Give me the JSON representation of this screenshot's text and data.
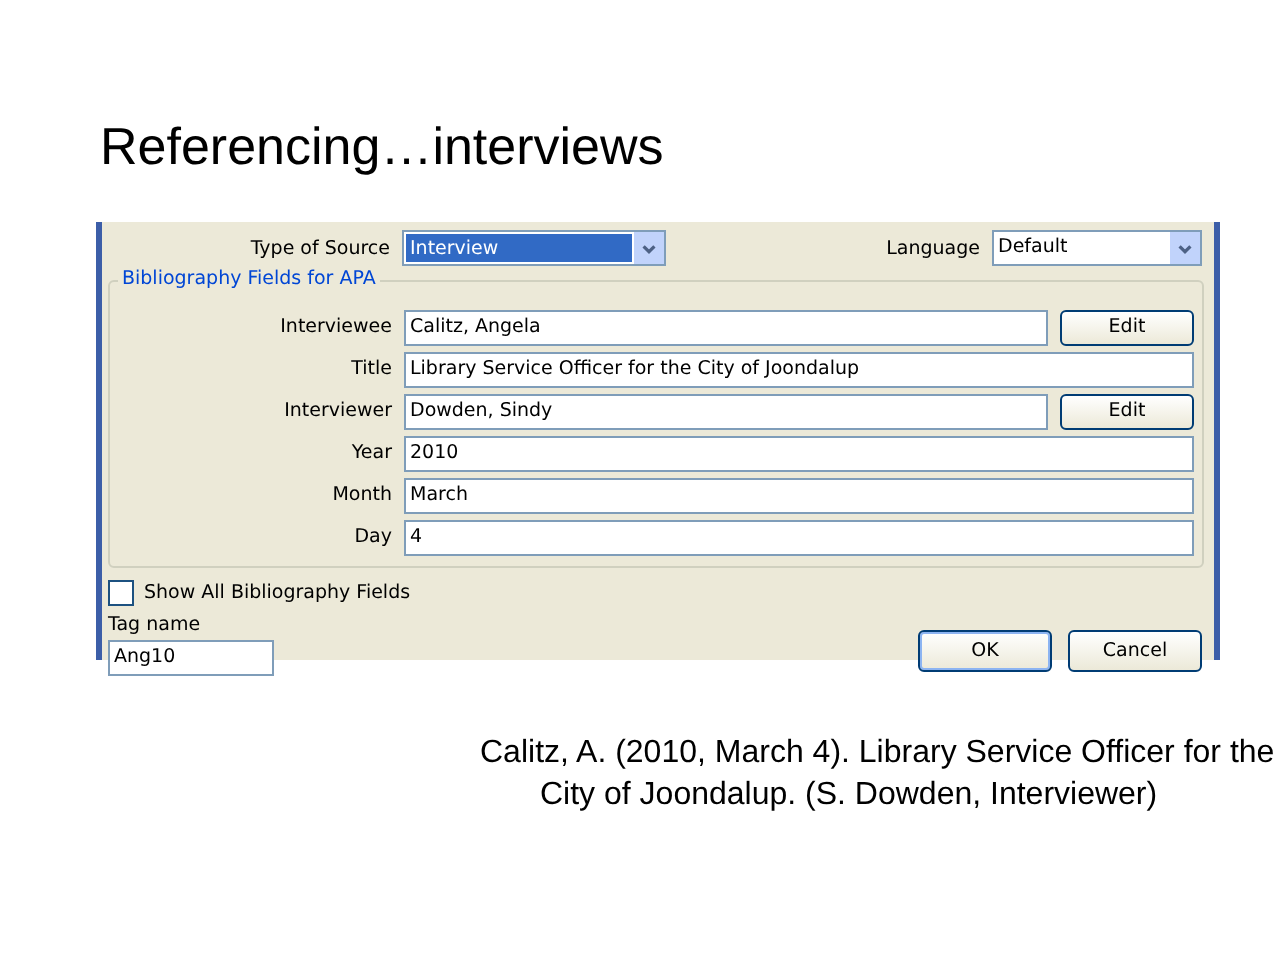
{
  "slide_title": "Referencing…interviews",
  "dialog": {
    "source_type": {
      "label": "Type of Source",
      "value": "Interview",
      "selected": true
    },
    "language": {
      "label": "Language",
      "value": "Default"
    },
    "group": {
      "legend": "Bibliography Fields for APA",
      "fields": [
        {
          "label": "Interviewee",
          "value": "Calitz, Angela",
          "button": "Edit"
        },
        {
          "label": "Title",
          "value": "Library Service Officer for the City of Joondalup"
        },
        {
          "label": "Interviewer",
          "value": "Dowden, Sindy",
          "button": "Edit"
        },
        {
          "label": "Year",
          "value": "2010"
        },
        {
          "label": "Month",
          "value": "March"
        },
        {
          "label": "Day",
          "value": "4"
        }
      ]
    },
    "show_all": {
      "label": "Show All Bibliography Fields",
      "checked": false
    },
    "tag_name": {
      "label": "Tag name",
      "value": "Ang10"
    },
    "buttons": [
      {
        "label": "OK",
        "kind": "default"
      },
      {
        "label": "Cancel",
        "kind": "normal"
      }
    ]
  },
  "citation": "Calitz, A. (2010, March 4). Library Service Officer for the City of Joondalup. (S. Dowden, Interviewer)"
}
